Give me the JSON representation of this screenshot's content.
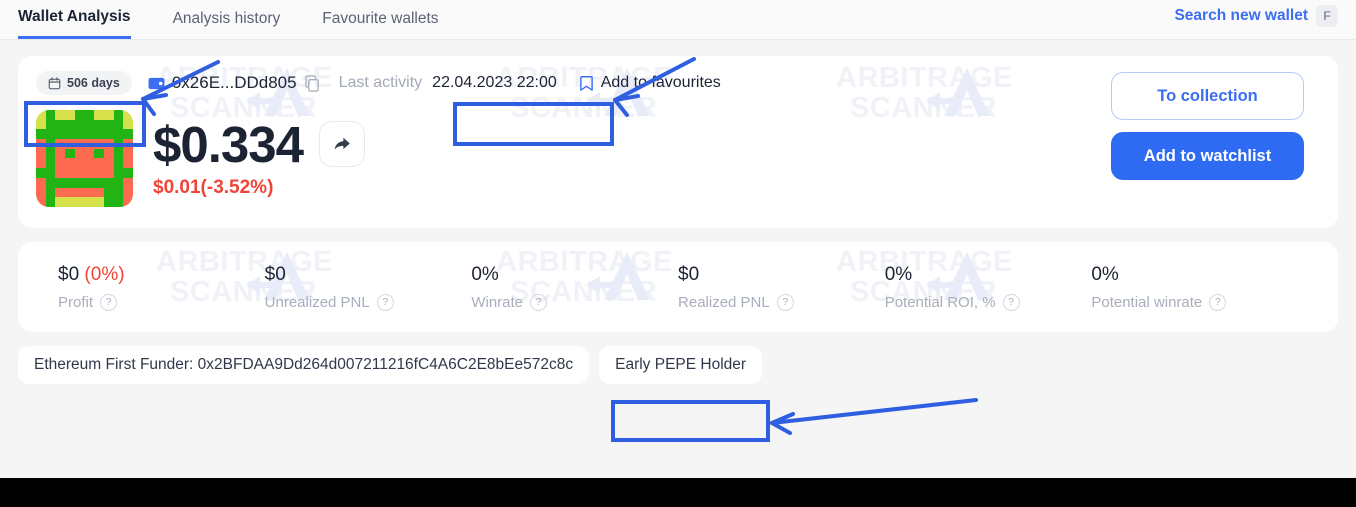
{
  "topbar": {
    "tabs": [
      {
        "label": "Wallet Analysis",
        "active": true
      },
      {
        "label": "Analysis history",
        "active": false
      },
      {
        "label": "Favourite wallets",
        "active": false
      }
    ],
    "search_link": "Search new wallet",
    "search_shortcut": "F"
  },
  "wallet": {
    "age_badge": "506 days",
    "address_short": "0x26E...DDd805",
    "last_activity_label": "Last activity",
    "last_activity_value": "22.04.2023 22:00",
    "favourite_label": "Add to favourites",
    "price": "$0.334",
    "change": "$0.01(-3.52%)",
    "to_collection_label": "To collection",
    "add_watchlist_label": "Add to watchlist"
  },
  "stats": [
    {
      "value": "$0",
      "value_extra": "(0%)",
      "label": "Profit"
    },
    {
      "value": "$0",
      "value_extra": "",
      "label": "Unrealized PNL"
    },
    {
      "value": "0%",
      "value_extra": "",
      "label": "Winrate"
    },
    {
      "value": "$0",
      "value_extra": "",
      "label": "Realized PNL"
    },
    {
      "value": "0%",
      "value_extra": "",
      "label": "Potential ROI, %"
    },
    {
      "value": "0%",
      "value_extra": "",
      "label": "Potential winrate"
    }
  ],
  "tags": [
    "Ethereum First Funder: 0x2BFDAA9Dd264d007211216fC4A6C2E8bEe572c8c",
    "Early PEPE Holder"
  ],
  "watermark": {
    "line1": "ARBITRAGE",
    "line2": "SCANNER"
  },
  "icons": {
    "calendar": "calendar-icon",
    "wallet": "wallet-icon",
    "copy": "copy-icon",
    "bookmark": "bookmark-icon",
    "share": "share-icon",
    "help": "?"
  },
  "colors": {
    "accent": "#2f6bf2",
    "link": "#3b6ef0",
    "negative": "#f04438",
    "text": "#1c2333",
    "muted": "#a8aeba",
    "page_bg": "#f5f5f6",
    "card_bg": "#ffffff",
    "annotation": "#2f5fe0",
    "avatar_green": "#22b315",
    "avatar_lime": "#d6e04a",
    "avatar_salmon": "#fc6a4f"
  },
  "avatar_grid": [
    "lime",
    "green",
    "lime",
    "lime",
    "green",
    "green",
    "lime",
    "lime",
    "green",
    "lime",
    "lime",
    "green",
    "green",
    "green",
    "green",
    "green",
    "green",
    "green",
    "green",
    "lime",
    "green",
    "green",
    "green",
    "green",
    "green",
    "green",
    "green",
    "green",
    "green",
    "green",
    "salmon",
    "green",
    "salmon",
    "salmon",
    "salmon",
    "salmon",
    "salmon",
    "salmon",
    "green",
    "salmon",
    "salmon",
    "green",
    "salmon",
    "green",
    "salmon",
    "salmon",
    "green",
    "salmon",
    "green",
    "salmon",
    "salmon",
    "green",
    "salmon",
    "salmon",
    "salmon",
    "salmon",
    "salmon",
    "salmon",
    "green",
    "salmon",
    "green",
    "green",
    "salmon",
    "salmon",
    "salmon",
    "salmon",
    "salmon",
    "salmon",
    "green",
    "green",
    "salmon",
    "green",
    "green",
    "green",
    "green",
    "green",
    "green",
    "green",
    "green",
    "salmon",
    "salmon",
    "green",
    "salmon",
    "salmon",
    "salmon",
    "salmon",
    "salmon",
    "green",
    "green",
    "salmon",
    "salmon",
    "green",
    "lime",
    "lime",
    "lime",
    "lime",
    "lime",
    "green",
    "green",
    "salmon"
  ]
}
